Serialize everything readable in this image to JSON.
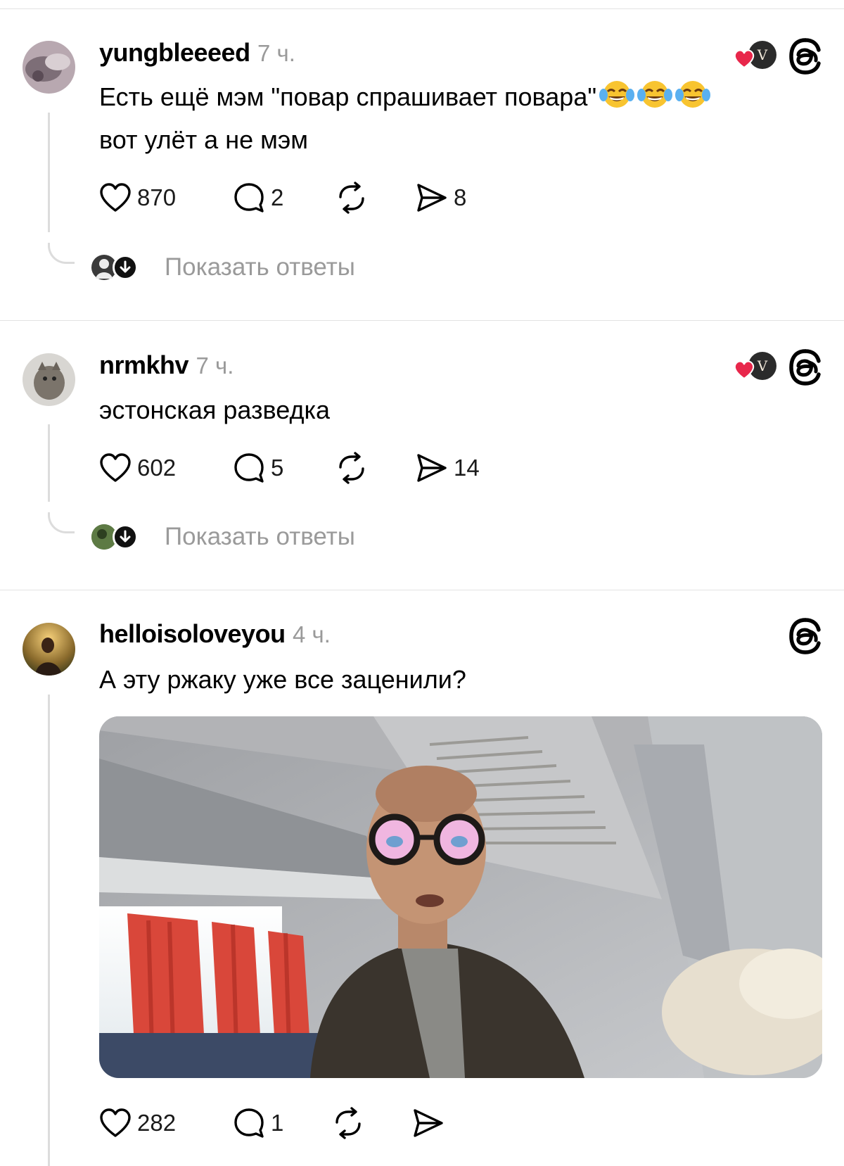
{
  "posts": [
    {
      "username": "yungbleeeed",
      "time": "7 ч.",
      "text": "Есть ещё мэм \"повар спрашивает повара\"",
      "text_line2": "вот улёт а не мэм",
      "emojis": [
        "😂",
        "😂",
        "😂"
      ],
      "likes": "870",
      "replies": "2",
      "reposts": "",
      "shares": "8",
      "show_replies": "Показать ответы",
      "liked_by_author": true
    },
    {
      "username": "nrmkhv",
      "time": "7 ч.",
      "text": "эстонская разведка",
      "likes": "602",
      "replies": "5",
      "reposts": "",
      "shares": "14",
      "show_replies": "Показать ответы",
      "liked_by_author": true
    },
    {
      "username": "helloisoloveyou",
      "time": "4 ч.",
      "text": "А эту ржаку уже все заценили?",
      "likes": "282",
      "replies": "1",
      "reposts": "",
      "shares": "",
      "has_media": true
    }
  ],
  "icons": [
    "heart-icon",
    "comment-icon",
    "repost-icon",
    "share-icon",
    "threads-logo-icon",
    "down-arrow-icon",
    "liked-heart-icon"
  ],
  "colors": {
    "liked_heart": "#e8274b",
    "muted_text": "#9a9a9a",
    "divider": "#e3e3e3"
  }
}
